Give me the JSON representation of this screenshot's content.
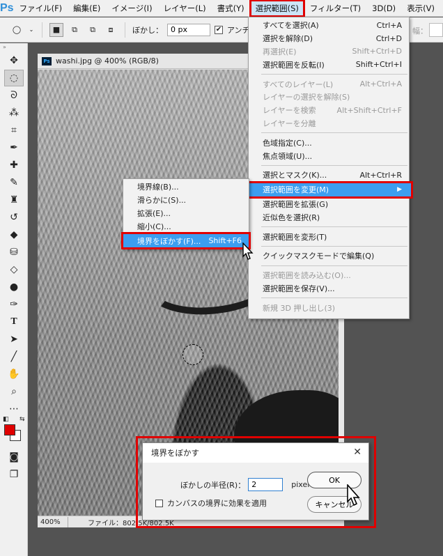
{
  "menubar": {
    "logo": "Ps",
    "items": [
      "ファイル(F)",
      "編集(E)",
      "イメージ(I)",
      "レイヤー(L)",
      "書式(Y)",
      "選択範囲(S)",
      "フィルター(T)",
      "3D(D)",
      "表示(V)",
      "ウ"
    ]
  },
  "options": {
    "feather_label": "ぼかし：",
    "feather_value": "0 px",
    "antialias_label": "アンチ",
    "width_label": "幅："
  },
  "document": {
    "tab_title": "washi.jpg @ 400% (RGB/8)",
    "zoom": "400%",
    "file_info": "ファイル：802.5K/802.5K"
  },
  "select_menu": {
    "items": [
      {
        "label": "すべてを選択(A)",
        "shortcut": "Ctrl+A",
        "disabled": false
      },
      {
        "label": "選択を解除(D)",
        "shortcut": "Ctrl+D",
        "disabled": false
      },
      {
        "label": "再選択(E)",
        "shortcut": "Shift+Ctrl+D",
        "disabled": true
      },
      {
        "label": "選択範囲を反転(I)",
        "shortcut": "Shift+Ctrl+I",
        "disabled": false
      },
      {
        "label": "すべてのレイヤー(L)",
        "shortcut": "Alt+Ctrl+A",
        "disabled": true
      },
      {
        "label": "レイヤーの選択を解除(S)",
        "shortcut": "",
        "disabled": true
      },
      {
        "label": "レイヤーを検索",
        "shortcut": "Alt+Shift+Ctrl+F",
        "disabled": true
      },
      {
        "label": "レイヤーを分離",
        "shortcut": "",
        "disabled": true
      },
      {
        "label": "色域指定(C)...",
        "shortcut": "",
        "disabled": false
      },
      {
        "label": "焦点領域(U)...",
        "shortcut": "",
        "disabled": false
      },
      {
        "label": "選択とマスク(K)...",
        "shortcut": "Alt+Ctrl+R",
        "disabled": false
      },
      {
        "label": "選択範囲を変更(M)",
        "shortcut": "",
        "disabled": false
      },
      {
        "label": "選択範囲を拡張(G)",
        "shortcut": "",
        "disabled": false
      },
      {
        "label": "近似色を選択(R)",
        "shortcut": "",
        "disabled": false
      },
      {
        "label": "選択範囲を変形(T)",
        "shortcut": "",
        "disabled": false
      },
      {
        "label": "クイックマスクモードで編集(Q)",
        "shortcut": "",
        "disabled": false
      },
      {
        "label": "選択範囲を読み込む(O)...",
        "shortcut": "",
        "disabled": true
      },
      {
        "label": "選択範囲を保存(V)...",
        "shortcut": "",
        "disabled": false
      },
      {
        "label": "新規 3D 押し出し(3)",
        "shortcut": "",
        "disabled": true
      }
    ]
  },
  "modify_submenu": {
    "items": [
      {
        "label": "境界線(B)...",
        "shortcut": ""
      },
      {
        "label": "滑らかに(S)...",
        "shortcut": ""
      },
      {
        "label": "拡張(E)...",
        "shortcut": ""
      },
      {
        "label": "縮小(C)...",
        "shortcut": ""
      },
      {
        "label": "境界をぼかす(F)...",
        "shortcut": "Shift+F6"
      }
    ]
  },
  "dialog": {
    "title": "境界をぼかす",
    "radius_label": "ぼかしの半径(R)：",
    "radius_value": "2",
    "unit": "pixel",
    "checkbox_label": "カンバスの境界に効果を適用",
    "ok_label": "OK",
    "cancel_label": "キャンセル",
    "close_glyph": "✕"
  },
  "colors": {
    "highlight": "#3c9ef0",
    "callout": "#e00000",
    "foreground": "#e00000"
  }
}
